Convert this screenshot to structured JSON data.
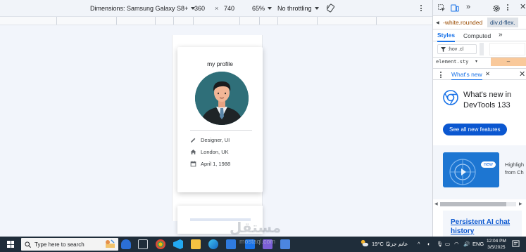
{
  "device_toolbar": {
    "dimensions_label": "Dimensions: Samsung Galaxy S8+",
    "width": "360",
    "times": "×",
    "height": "740",
    "zoom": "65%",
    "throttling": "No throttling"
  },
  "profile_card": {
    "title": "my profile",
    "items": [
      {
        "icon": "pencil-icon",
        "text": "Designer, UI"
      },
      {
        "icon": "home-icon",
        "text": "London, UK"
      },
      {
        "icon": "calendar-icon",
        "text": "April 1, 1988"
      }
    ],
    "avatar_bg": "#2f6f79"
  },
  "devtools": {
    "breadcrumb_1": "-white.rounded",
    "breadcrumb_2": "div.d-flex.",
    "tab_styles": "Styles",
    "tab_computed": "Computed",
    "filter_placeholder": ":hov .cl",
    "element_style": "element.sty",
    "element_value": "–",
    "drawer_tab": "What's new",
    "whats_new_title": "What's new in DevTools 133",
    "see_all_button": "See all new features",
    "new_badge": "new",
    "feature_text_1": "Highligh",
    "feature_text_2": "from Ch",
    "ai_title": "Persistent AI chat history",
    "accent": "#1a73e8"
  },
  "taskbar": {
    "search_placeholder": "Type here to search",
    "weather": "19°C",
    "weather_arabic": "عاتم جزئيًا",
    "language": "ENG",
    "time": "12:04 PM",
    "date": "3/5/2025",
    "watermark": "مستقل",
    "watermark_sub": "mostaql.com"
  }
}
